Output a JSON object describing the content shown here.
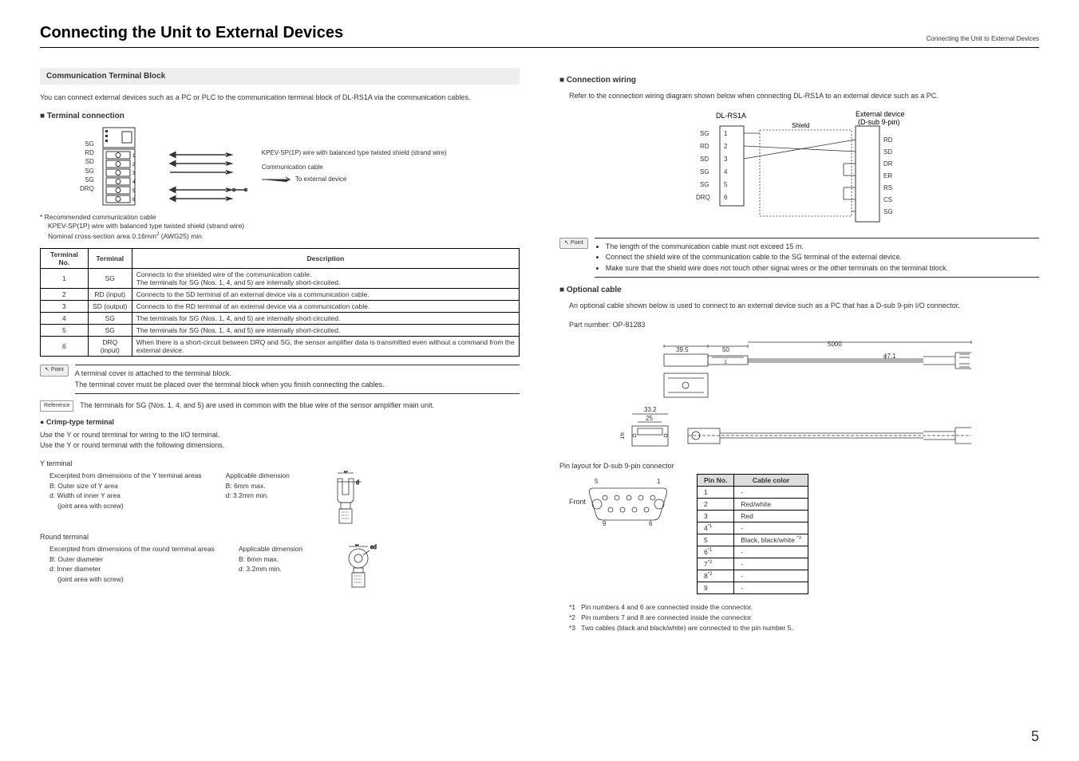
{
  "header": {
    "title": "Connecting the Unit to External Devices",
    "right": "Connecting the Unit to External Devices"
  },
  "left": {
    "section_title": "Communication Terminal Block",
    "intro": "You can connect external devices such as a PC or PLC to the communication terminal block of DL-RS1A via the communication cables.",
    "terminal_connection_heading": "Terminal connection",
    "diag": {
      "labels": [
        "SG",
        "RD",
        "SD",
        "SG",
        "SG",
        "DRQ"
      ],
      "wire_note": "KPEV-SP(1P) wire with balanced type twisted shield (strand wire)",
      "comm_cable": "Communication cable",
      "to_ext": "To external device"
    },
    "rec_cable_prefix": "* ",
    "rec_cable_title": "Recommended communication cable",
    "rec_cable_line1": "KPEV-SP(1P) wire with balanced type twisted shield (strand wire)",
    "rec_cable_line2": "Nominal cross-section area 0.16mm",
    "rec_cable_line2_suffix": " (AWG25) min.",
    "terminal_table": {
      "headers": [
        "Terminal No.",
        "Terminal",
        "Description"
      ],
      "rows": [
        {
          "no": "1",
          "term": "SG",
          "desc": "Connects to the shielded wire of the communication cable.\nThe terminals for SG (Nos. 1, 4, and 5) are internally short-circuited."
        },
        {
          "no": "2",
          "term": "RD (input)",
          "desc": "Connects to the SD terminal of an external device via a communication cable."
        },
        {
          "no": "3",
          "term": "SD (output)",
          "desc": "Connects to the RD terminal of an external device via a communication cable."
        },
        {
          "no": "4",
          "term": "SG",
          "desc": "The terminals for SG (Nos. 1, 4, and 5) are internally short-circuited."
        },
        {
          "no": "5",
          "term": "SG",
          "desc": "The terminals for SG (Nos. 1, 4, and 5) are internally short-circuited."
        },
        {
          "no": "6",
          "term": "DRQ (input)",
          "desc": "When there is a short-circuit between DRQ and SG, the sensor amplifier data is transmitted even without a command from the external device."
        }
      ]
    },
    "point_label": "Point",
    "point_text1": "A terminal cover is attached to the terminal block.",
    "point_text2": "The terminal cover must be placed over the terminal block when you finish connecting the cables.",
    "ref_label": "Reference",
    "ref_text": "The terminals for SG (Nos. 1, 4, and 5) are used in common with the blue wire of the sensor amplifier main unit.",
    "crimp_heading": "Crimp-type terminal",
    "crimp_text1": "Use the Y or round terminal for wiring to the I/O terminal.",
    "crimp_text2": "Use the Y or round terminal with the following dimensions.",
    "y_terminal_heading": "Y terminal",
    "y_terminal": {
      "excerpt": "Excerpted from dimensions of the Y terminal areas",
      "b_label": "B: Outer size of Y area",
      "d_label": "d: Width of inner Y area",
      "joint": "(joint area with screw)",
      "applicable": "Applicable dimension",
      "b_dim": "B: 6mm max.",
      "d_dim": "d: 3.2mm min.",
      "svg_B": "B",
      "svg_d": "d"
    },
    "round_terminal_heading": "Round terminal",
    "round_terminal": {
      "excerpt": "Excerpted from dimensions of the round terminal areas",
      "b_label": "B: Outer diameter",
      "d_label": "d: Inner diameter",
      "joint": "(joint area with screw)",
      "applicable": "Applicable dimension",
      "b_dim": "B: 6mm max.",
      "d_dim": "d: 3.2mm min.",
      "svg_B": "B",
      "svg_ed": "ed"
    }
  },
  "right": {
    "conn_wiring_heading": "Connection wiring",
    "conn_wiring_text": "Refer to the connection wiring diagram shown below when connecting DL-RS1A to an external device such as a PC.",
    "wiring": {
      "left_title": "DL-RS1A",
      "right_title_1": "External device",
      "right_title_2": "(D-sub 9-pin)",
      "shield": "Shield",
      "left_pins": [
        {
          "name": "SG",
          "num": "1"
        },
        {
          "name": "RD",
          "num": "2"
        },
        {
          "name": "SD",
          "num": "3"
        },
        {
          "name": "SG",
          "num": "4"
        },
        {
          "name": "SG",
          "num": "5"
        },
        {
          "name": "DRQ",
          "num": "6"
        }
      ],
      "right_pins": [
        "RD",
        "SD",
        "DR",
        "ER",
        "RS",
        "CS",
        "SG"
      ]
    },
    "point_label": "Point",
    "point_bullets": [
      "The length of the communication cable must not exceed 15 m.",
      "Connect the shield wire of the communication cable to the SG terminal of the external device.",
      "Make sure that the shield wire does not touch other signal wires or the other terminals on the terminal block."
    ],
    "optional_cable_heading": "Optional cable",
    "optional_text": "An optional cable shown below is used to connect to an external device such as a PC that has a D-sub 9-pin I/O connector.",
    "part_number_text": "Part number: OP-81283",
    "cable_dims": {
      "d1": "39.5",
      "d2": "50",
      "d3": "5000",
      "d4": "1",
      "d5": "ϕ7.1",
      "d6": "33.2",
      "d7": "25",
      "d8": "16"
    },
    "pin_layout_heading": "Pin layout for D-sub 9-pin connector",
    "pin_conn": {
      "front": "Front",
      "p5": "5",
      "p1": "1",
      "p9": "9",
      "p6": "6"
    },
    "pin_table": {
      "headers": [
        "Pin No.",
        "Cable color"
      ],
      "rows": [
        {
          "pin": "1",
          "color": "-"
        },
        {
          "pin": "2",
          "color": "Red/white"
        },
        {
          "pin": "3",
          "color": "Red"
        },
        {
          "pin": "4*1",
          "color": "-"
        },
        {
          "pin": "5",
          "color": "Black, black/white *3"
        },
        {
          "pin": "6*1",
          "color": "-"
        },
        {
          "pin": "7*2",
          "color": "-"
        },
        {
          "pin": "8*2",
          "color": "-"
        },
        {
          "pin": "9",
          "color": "-"
        }
      ]
    },
    "footnotes": [
      {
        "mark": "*1",
        "text": "Pin numbers 4 and 6 are connected inside the connector."
      },
      {
        "mark": "*2",
        "text": "Pin numbers 7 and 8 are connected inside the connector."
      },
      {
        "mark": "*3",
        "text": "Two cables (black and black/white) are connected to the pin number 5."
      }
    ]
  },
  "page_number": "5"
}
